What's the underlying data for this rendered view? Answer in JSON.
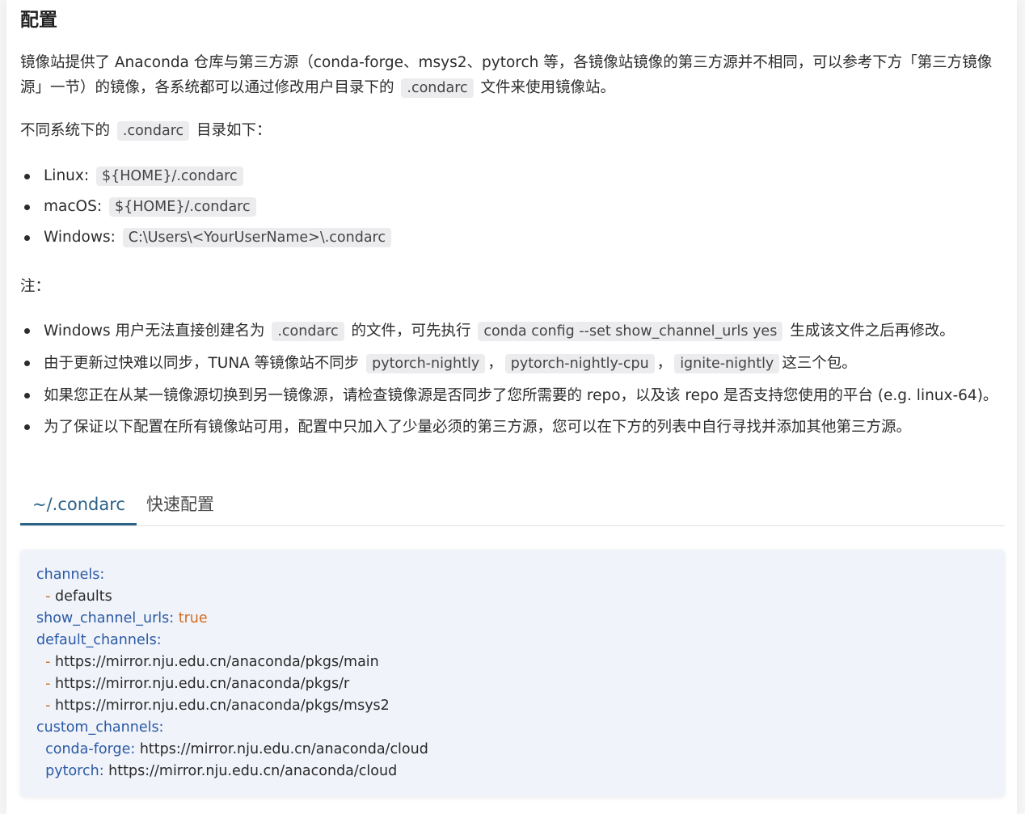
{
  "heading": "配置",
  "intro": {
    "text1": "镜像站提供了 Anaconda 仓库与第三方源（conda-forge、msys2、pytorch 等，各镜像站镜像的第三方源并不相同，可以参考下方「第三方镜像源」一节）的镜像，各系统都可以通过修改用户目录下的",
    "code": ".condarc",
    "text2": "文件来使用镜像站。"
  },
  "dirs_intro": {
    "text1": "不同系统下的",
    "code": ".condarc",
    "text2": "目录如下："
  },
  "systems": [
    {
      "label": "Linux:",
      "path": "${HOME}/.condarc"
    },
    {
      "label": "macOS:",
      "path": "${HOME}/.condarc"
    },
    {
      "label": "Windows:",
      "path": "C:\\Users\\<YourUserName>\\.condarc"
    }
  ],
  "note_label": "注：",
  "notes": {
    "n1": {
      "t1": "Windows 用户无法直接创建名为",
      "c1": ".condarc",
      "t2": "的文件，可先执行",
      "c2": "conda config --set show_channel_urls yes",
      "t3": "生成该文件之后再修改。"
    },
    "n2": {
      "t1": "由于更新过快难以同步，TUNA 等镜像站不同步",
      "c1": "pytorch-nightly",
      "s1": "，",
      "c2": "pytorch-nightly-cpu",
      "s2": "，",
      "c3": "ignite-nightly",
      "t2": "这三个包。"
    },
    "n3": "如果您正在从某一镜像源切换到另一镜像源，请检查镜像源是否同步了您所需要的 repo，以及该 repo 是否支持您使用的平台 (e.g. linux-64)。",
    "n4": "为了保证以下配置在所有镜像站可用，配置中只加入了少量必须的第三方源，您可以在下方的列表中自行寻找并添加其他第三方源。"
  },
  "tabs": [
    {
      "label": "~/.condarc",
      "active": true
    },
    {
      "label": "快速配置",
      "active": false
    }
  ],
  "code": {
    "channels_key": "channels:",
    "dash": "-",
    "defaults": "defaults",
    "show_key": "show_channel_urls:",
    "show_val": "true",
    "default_channels_key": "default_channels:",
    "default_channels": [
      "https://mirror.nju.edu.cn/anaconda/pkgs/main",
      "https://mirror.nju.edu.cn/anaconda/pkgs/r",
      "https://mirror.nju.edu.cn/anaconda/pkgs/msys2"
    ],
    "custom_key": "custom_channels:",
    "conda_forge_key": "conda-forge:",
    "conda_forge_val": "https://mirror.nju.edu.cn/anaconda/cloud",
    "pytorch_key": "pytorch:",
    "pytorch_val": "https://mirror.nju.edu.cn/anaconda/cloud"
  },
  "colors": {
    "accent": "#2b6287",
    "code_key": "#2a5aa5",
    "code_bool": "#d46c1f",
    "code_bg": "#f0f3f9",
    "inline_code_bg": "#ececee"
  }
}
